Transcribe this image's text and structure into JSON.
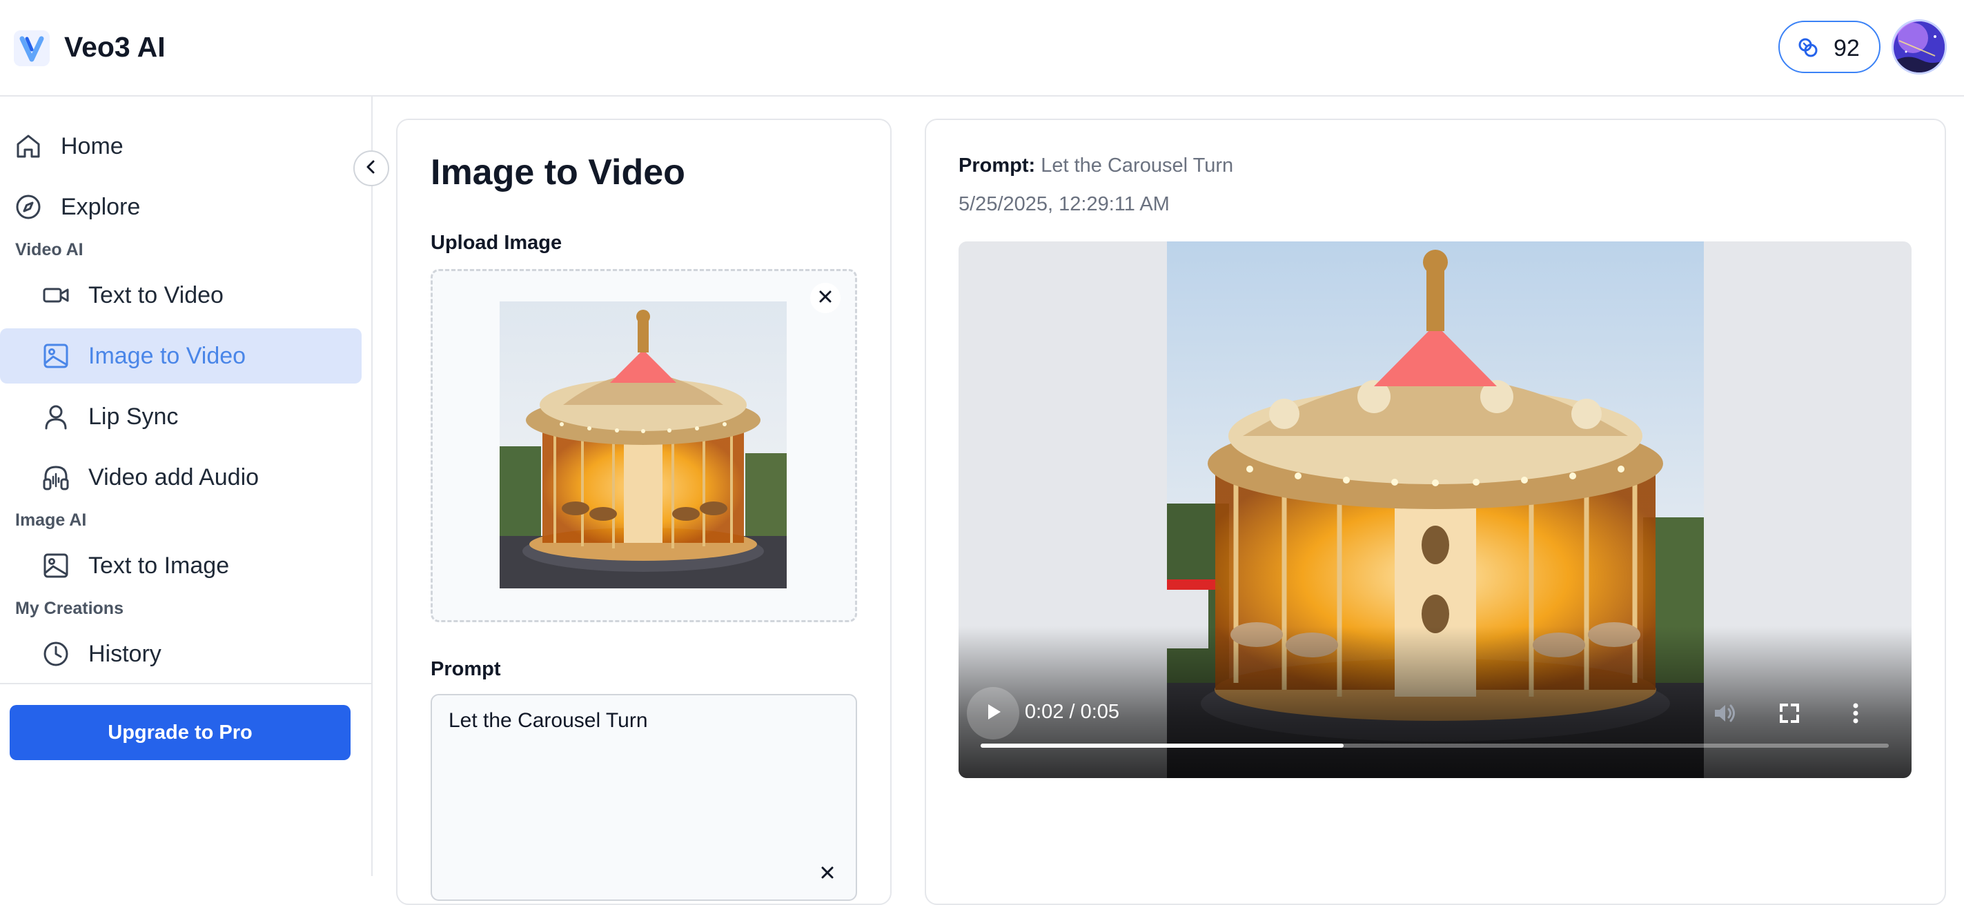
{
  "header": {
    "app_title": "Veo3 AI",
    "logo_letter": "V",
    "credits": "92",
    "credits_icon": "coins-icon",
    "avatar_icon": "user-avatar"
  },
  "sidebar": {
    "items": [
      {
        "label": "Home",
        "icon": "home-icon"
      },
      {
        "label": "Explore",
        "icon": "compass-icon"
      }
    ],
    "sections": [
      {
        "label": "Video AI",
        "items": [
          {
            "label": "Text to Video",
            "icon": "video-camera-icon"
          },
          {
            "label": "Image to Video",
            "icon": "image-icon",
            "active": true
          },
          {
            "label": "Lip Sync",
            "icon": "user-icon"
          },
          {
            "label": "Video add Audio",
            "icon": "headphones-icon"
          }
        ]
      },
      {
        "label": "Image AI",
        "items": [
          {
            "label": "Text to Image",
            "icon": "image-icon"
          }
        ]
      },
      {
        "label": "My Creations",
        "items": [
          {
            "label": "History",
            "icon": "clock-icon"
          }
        ]
      }
    ],
    "upgrade_label": "Upgrade to Pro",
    "collapse_icon": "chevron-left-icon"
  },
  "form": {
    "title": "Image to Video",
    "upload_label": "Upload Image",
    "prompt_label": "Prompt",
    "prompt_value": "Let the Carousel Turn"
  },
  "result": {
    "prompt_key": "Prompt:",
    "prompt_value": "Let the Carousel Turn",
    "timestamp": "5/25/2025, 12:29:11 AM",
    "video": {
      "time": "0:02 / 0:05",
      "progress": 0.4
    }
  },
  "colors": {
    "accent": "#2563eb",
    "active_bg": "#dbe5fb",
    "active_text": "#4a86e8"
  }
}
